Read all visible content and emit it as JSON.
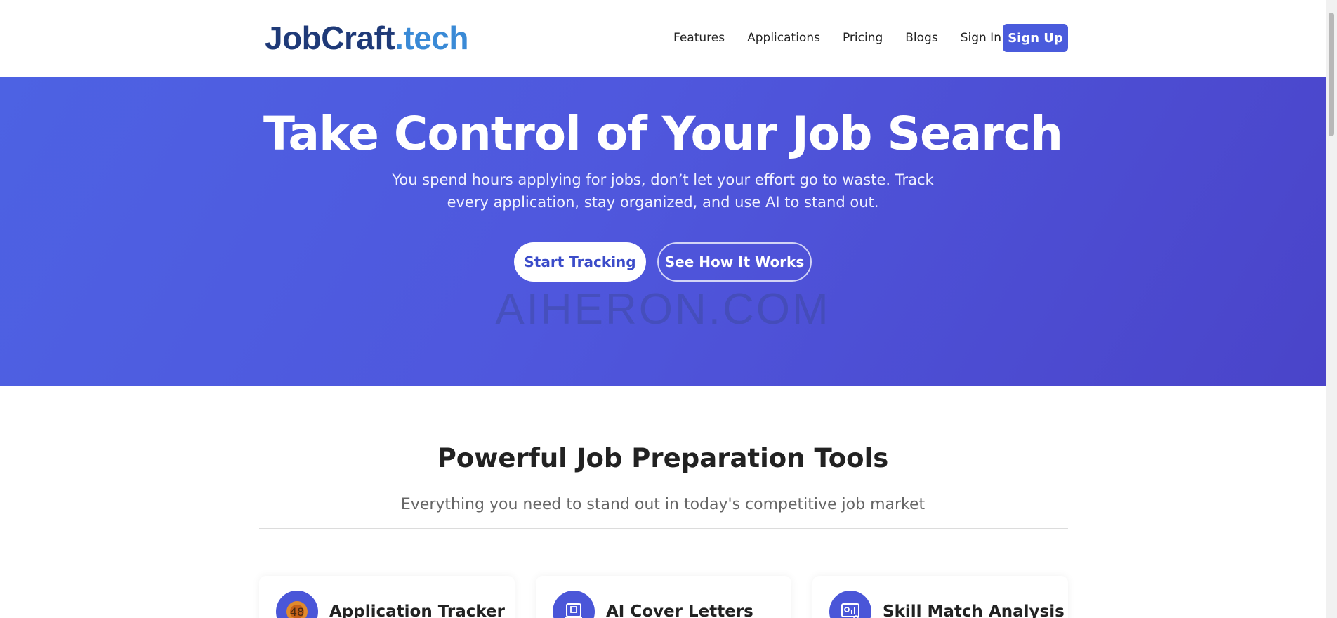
{
  "header": {
    "logo_brand": "JobCraft",
    "logo_tld": ".tech",
    "nav": [
      "Features",
      "Applications",
      "Pricing",
      "Blogs",
      "Sign In"
    ],
    "signup_label": "Sign Up"
  },
  "hero": {
    "title": "Take Control of Your Job Search",
    "subtitle": "You spend hours applying for jobs, don’t let your effort go to waste. Track every application, stay organized, and use AI to stand out.",
    "primary_cta": "Start Tracking",
    "secondary_cta": "See How It Works",
    "watermark": "AIHERON.COM"
  },
  "tools": {
    "title": "Powerful Job Preparation Tools",
    "subtitle": "Everything you need to stand out in today's competitive job market",
    "cards": [
      {
        "title": "Application Tracker",
        "icon": "tracker-icon"
      },
      {
        "title": "AI Cover Letters",
        "icon": "cover-letter-icon"
      },
      {
        "title": "Skill Match Analysis",
        "icon": "skill-analysis-icon"
      }
    ]
  },
  "colors": {
    "brand_dark": "#1f3a78",
    "brand_light": "#3a8ad6",
    "accent": "#4a5bdc",
    "hero_gradient_start": "#4d62e3",
    "hero_gradient_end": "#4a44c9"
  }
}
